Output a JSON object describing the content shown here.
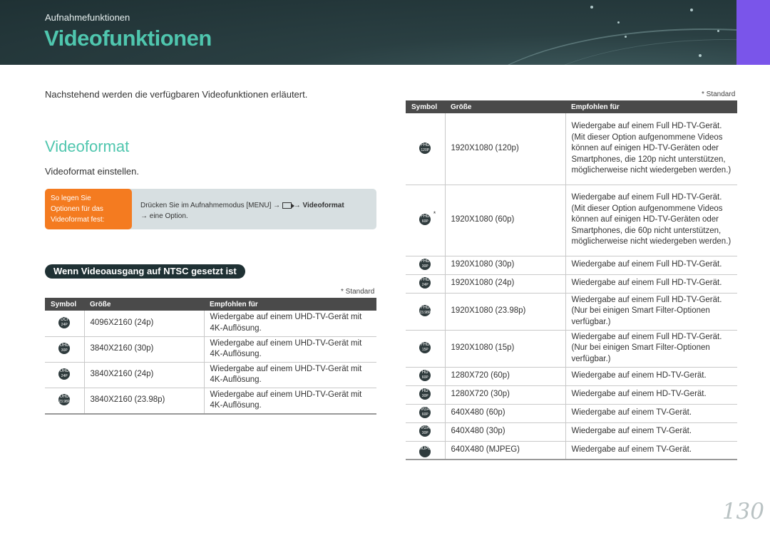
{
  "header": {
    "breadcrumb": "Aufnahmefunktionen",
    "title": "Videofunktionen"
  },
  "intro": "Nachstehend werden die verfügbaren Videofunktionen erläutert.",
  "section": {
    "title": "Videoformat",
    "subtitle": "Videoformat einstellen."
  },
  "howto": {
    "label_lines": [
      "So legen Sie",
      "Optionen für das",
      "Videoformat fest:"
    ],
    "text_pre": "Drücken Sie im Aufnahmemodus [MENU] → ",
    "video_icon": "video-camera-icon",
    "text_arrow": " → ",
    "text_bold": "Videoformat",
    "text_line2": "→ eine Option."
  },
  "ntsc_title": "Wenn Videoausgang auf NTSC gesetzt ist",
  "standard_note": "* Standard",
  "table_headers": {
    "symbol": "Symbol",
    "size": "Größe",
    "recommended": "Empfohlen für"
  },
  "left_table": [
    {
      "badge": [
        "DCI",
        "24P"
      ],
      "default": false,
      "size": "4096X2160 (24p)",
      "rec": "Wiedergabe auf einem UHD-TV-Gerät mit 4K-Auflösung."
    },
    {
      "badge": [
        "UHD",
        "30P"
      ],
      "default": false,
      "size": "3840X2160 (30p)",
      "rec": "Wiedergabe auf einem UHD-TV-Gerät mit 4K-Auflösung."
    },
    {
      "badge": [
        "UHD",
        "24P"
      ],
      "default": false,
      "size": "3840X2160 (24p)",
      "rec": "Wiedergabe auf einem UHD-TV-Gerät mit 4K-Auflösung."
    },
    {
      "badge": [
        "UHD",
        "23.98P"
      ],
      "default": false,
      "size": "3840X2160 (23.98p)",
      "rec": "Wiedergabe auf einem UHD-TV-Gerät mit 4K-Auflösung."
    }
  ],
  "right_table": [
    {
      "badge": [
        "FHD",
        "120P"
      ],
      "default": false,
      "size": "1920X1080 (120p)",
      "rec": "Wiedergabe auf einem Full HD-TV-Gerät. (Mit dieser Option aufgenommene Videos können auf einigen HD-TV-Geräten oder Smartphones, die 120p nicht unterstützen, möglicherweise nicht wiedergeben werden.)"
    },
    {
      "badge": [
        "FHD",
        "60P"
      ],
      "default": true,
      "size": "1920X1080 (60p)",
      "rec": "Wiedergabe auf einem Full HD-TV-Gerät. (Mit dieser Option aufgenommene Videos können auf einigen HD-TV-Geräten oder Smartphones, die 60p nicht unterstützen, möglicherweise nicht wiedergeben werden.)"
    },
    {
      "badge": [
        "FHD",
        "30P"
      ],
      "default": false,
      "size": "1920X1080 (30p)",
      "rec": "Wiedergabe auf einem Full HD-TV-Gerät."
    },
    {
      "badge": [
        "FHD",
        "24P"
      ],
      "default": false,
      "size": "1920X1080 (24p)",
      "rec": "Wiedergabe auf einem Full HD-TV-Gerät."
    },
    {
      "badge": [
        "FHD",
        "23.98P"
      ],
      "default": false,
      "size": "1920X1080 (23.98p)",
      "rec": "Wiedergabe auf einem Full HD-TV-Gerät. (Nur bei einigen Smart Filter-Optionen verfügbar.)"
    },
    {
      "badge": [
        "FHD",
        "15P"
      ],
      "default": false,
      "size": "1920X1080 (15p)",
      "rec": "Wiedergabe auf einem Full HD-TV-Gerät. (Nur bei einigen Smart Filter-Optionen verfügbar.)"
    },
    {
      "badge": [
        "HD",
        "60P"
      ],
      "default": false,
      "size": "1280X720 (60p)",
      "rec": "Wiedergabe auf einem HD-TV-Gerät."
    },
    {
      "badge": [
        "HD",
        "30P"
      ],
      "default": false,
      "size": "1280X720 (30p)",
      "rec": "Wiedergabe auf einem HD-TV-Gerät."
    },
    {
      "badge": [
        "VGA",
        "60P"
      ],
      "default": false,
      "size": "640X480 (60p)",
      "rec": "Wiedergabe auf einem TV-Gerät."
    },
    {
      "badge": [
        "VGA",
        "30P"
      ],
      "default": false,
      "size": "640X480 (30p)",
      "rec": "Wiedergabe auf einem TV-Gerät."
    },
    {
      "badge": [
        "MJPEG",
        ""
      ],
      "default": false,
      "size": "640X480 (MJPEG)",
      "rec": "Wiedergabe auf einem TV-Gerät."
    }
  ],
  "page_number": "130"
}
